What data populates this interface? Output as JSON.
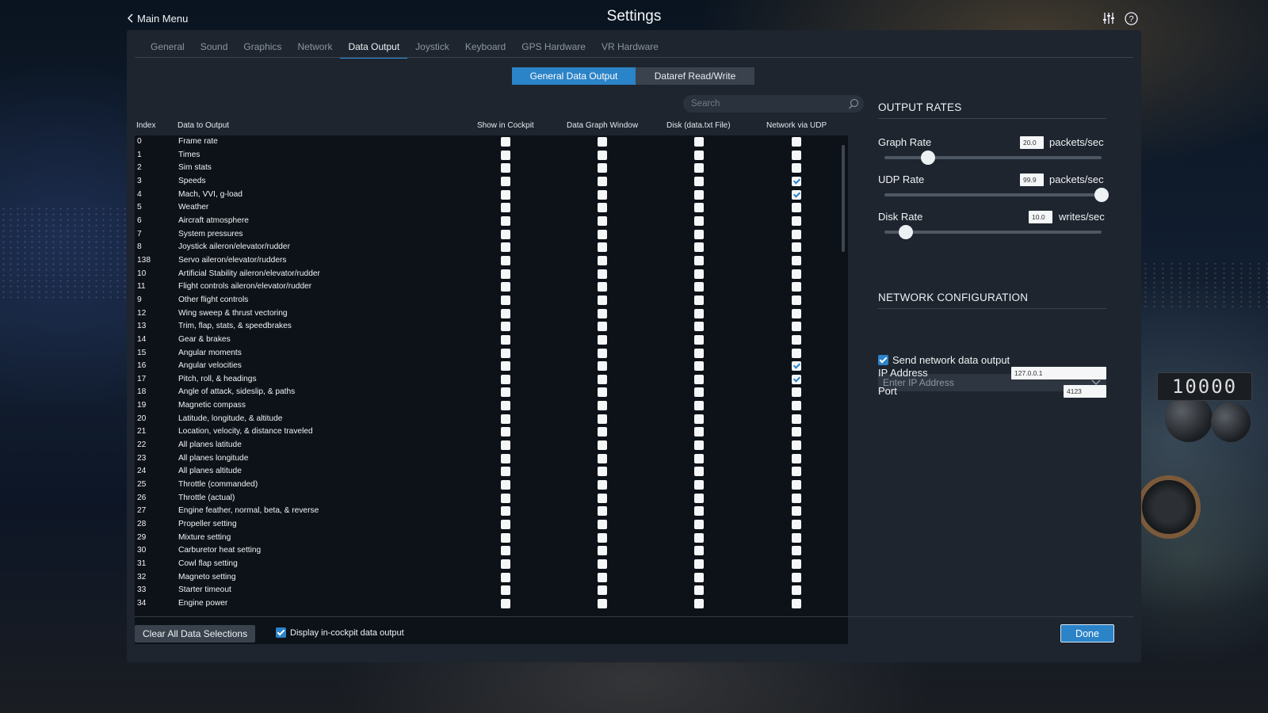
{
  "header": {
    "back_label": "Main Menu",
    "title": "Settings",
    "icons": [
      "sliders-icon",
      "help-icon"
    ]
  },
  "tabs": [
    {
      "label": "General",
      "active": false
    },
    {
      "label": "Sound",
      "active": false
    },
    {
      "label": "Graphics",
      "active": false
    },
    {
      "label": "Network",
      "active": false
    },
    {
      "label": "Data Output",
      "active": true
    },
    {
      "label": "Joystick",
      "active": false
    },
    {
      "label": "Keyboard",
      "active": false
    },
    {
      "label": "GPS Hardware",
      "active": false
    },
    {
      "label": "VR Hardware",
      "active": false
    }
  ],
  "subtabs": {
    "general_label": "General Data Output",
    "dataref_label": "Dataref Read/Write",
    "active": "general"
  },
  "search": {
    "placeholder": "Search",
    "value": ""
  },
  "table": {
    "headers": {
      "index": "Index",
      "data": "Data to Output",
      "cockpit": "Show in Cockpit",
      "graph": "Data Graph Window",
      "disk": "Disk (data.txt File)",
      "udp": "Network via UDP"
    },
    "rows": [
      {
        "index": "0",
        "label": "Frame rate",
        "cockpit": false,
        "graph": false,
        "disk": false,
        "udp": false
      },
      {
        "index": "1",
        "label": "Times",
        "cockpit": false,
        "graph": false,
        "disk": false,
        "udp": false
      },
      {
        "index": "2",
        "label": "Sim stats",
        "cockpit": false,
        "graph": false,
        "disk": false,
        "udp": false
      },
      {
        "index": "3",
        "label": "Speeds",
        "cockpit": false,
        "graph": false,
        "disk": false,
        "udp": true
      },
      {
        "index": "4",
        "label": "Mach, VVI, g-load",
        "cockpit": false,
        "graph": false,
        "disk": false,
        "udp": true
      },
      {
        "index": "5",
        "label": "Weather",
        "cockpit": false,
        "graph": false,
        "disk": false,
        "udp": false
      },
      {
        "index": "6",
        "label": "Aircraft atmosphere",
        "cockpit": false,
        "graph": false,
        "disk": false,
        "udp": false
      },
      {
        "index": "7",
        "label": "System pressures",
        "cockpit": false,
        "graph": false,
        "disk": false,
        "udp": false
      },
      {
        "index": "8",
        "label": "Joystick aileron/elevator/rudder",
        "cockpit": false,
        "graph": false,
        "disk": false,
        "udp": false
      },
      {
        "index": "138",
        "label": "Servo aileron/elevator/rudders",
        "cockpit": false,
        "graph": false,
        "disk": false,
        "udp": false
      },
      {
        "index": "10",
        "label": "Artificial Stability aileron/elevator/rudder",
        "cockpit": false,
        "graph": false,
        "disk": false,
        "udp": false
      },
      {
        "index": "11",
        "label": "Flight controls aileron/elevator/rudder",
        "cockpit": false,
        "graph": false,
        "disk": false,
        "udp": false
      },
      {
        "index": "9",
        "label": "Other flight controls",
        "cockpit": false,
        "graph": false,
        "disk": false,
        "udp": false
      },
      {
        "index": "12",
        "label": "Wing sweep & thrust vectoring",
        "cockpit": false,
        "graph": false,
        "disk": false,
        "udp": false
      },
      {
        "index": "13",
        "label": "Trim, flap, stats, & speedbrakes",
        "cockpit": false,
        "graph": false,
        "disk": false,
        "udp": false
      },
      {
        "index": "14",
        "label": "Gear & brakes",
        "cockpit": false,
        "graph": false,
        "disk": false,
        "udp": false
      },
      {
        "index": "15",
        "label": "Angular moments",
        "cockpit": false,
        "graph": false,
        "disk": false,
        "udp": false
      },
      {
        "index": "16",
        "label": "Angular velocities",
        "cockpit": false,
        "graph": false,
        "disk": false,
        "udp": true
      },
      {
        "index": "17",
        "label": "Pitch, roll, & headings",
        "cockpit": false,
        "graph": false,
        "disk": false,
        "udp": true
      },
      {
        "index": "18",
        "label": "Angle of attack, sideslip, & paths",
        "cockpit": false,
        "graph": false,
        "disk": false,
        "udp": false
      },
      {
        "index": "19",
        "label": "Magnetic compass",
        "cockpit": false,
        "graph": false,
        "disk": false,
        "udp": false
      },
      {
        "index": "20",
        "label": "Latitude, longitude, & altitude",
        "cockpit": false,
        "graph": false,
        "disk": false,
        "udp": false
      },
      {
        "index": "21",
        "label": "Location, velocity, & distance traveled",
        "cockpit": false,
        "graph": false,
        "disk": false,
        "udp": false
      },
      {
        "index": "22",
        "label": "All planes latitude",
        "cockpit": false,
        "graph": false,
        "disk": false,
        "udp": false
      },
      {
        "index": "23",
        "label": "All planes longitude",
        "cockpit": false,
        "graph": false,
        "disk": false,
        "udp": false
      },
      {
        "index": "24",
        "label": "All planes altitude",
        "cockpit": false,
        "graph": false,
        "disk": false,
        "udp": false
      },
      {
        "index": "25",
        "label": "Throttle (commanded)",
        "cockpit": false,
        "graph": false,
        "disk": false,
        "udp": false
      },
      {
        "index": "26",
        "label": "Throttle (actual)",
        "cockpit": false,
        "graph": false,
        "disk": false,
        "udp": false
      },
      {
        "index": "27",
        "label": "Engine feather, normal, beta, & reverse",
        "cockpit": false,
        "graph": false,
        "disk": false,
        "udp": false
      },
      {
        "index": "28",
        "label": "Propeller setting",
        "cockpit": false,
        "graph": false,
        "disk": false,
        "udp": false
      },
      {
        "index": "29",
        "label": "Mixture setting",
        "cockpit": false,
        "graph": false,
        "disk": false,
        "udp": false
      },
      {
        "index": "30",
        "label": "Carburetor heat setting",
        "cockpit": false,
        "graph": false,
        "disk": false,
        "udp": false
      },
      {
        "index": "31",
        "label": "Cowl flap setting",
        "cockpit": false,
        "graph": false,
        "disk": false,
        "udp": false
      },
      {
        "index": "32",
        "label": "Magneto setting",
        "cockpit": false,
        "graph": false,
        "disk": false,
        "udp": false
      },
      {
        "index": "33",
        "label": "Starter timeout",
        "cockpit": false,
        "graph": false,
        "disk": false,
        "udp": false
      },
      {
        "index": "34",
        "label": "Engine power",
        "cockpit": false,
        "graph": false,
        "disk": false,
        "udp": false
      }
    ]
  },
  "output_rates": {
    "title": "OUTPUT RATES",
    "graph": {
      "label": "Graph Rate",
      "value": "20.0",
      "unit": "packets/sec",
      "level": 0.2
    },
    "udp": {
      "label": "UDP Rate",
      "value": "99.9",
      "unit": "packets/sec",
      "level": 1.0
    },
    "disk": {
      "label": "Disk Rate",
      "value": "10.0",
      "unit": "writes/sec",
      "level": 0.1
    }
  },
  "network_config": {
    "title": "NETWORK CONFIGURATION",
    "send_label": "Send network data output",
    "send_checked": true,
    "ip_dropdown_placeholder": "Enter IP Address",
    "ip_label": "IP Address",
    "ip_value": "127.0.0.1",
    "port_label": "Port",
    "port_value": "4123"
  },
  "footer": {
    "clear_label": "Clear All Data Selections",
    "display_label": "Display in-cockpit data output",
    "display_checked": true,
    "done_label": "Done"
  },
  "background": {
    "altitude_readout": "10000"
  },
  "colors": {
    "accent": "#2b83c8",
    "panel": "#1e252e",
    "table_bg": "#0d1218"
  }
}
